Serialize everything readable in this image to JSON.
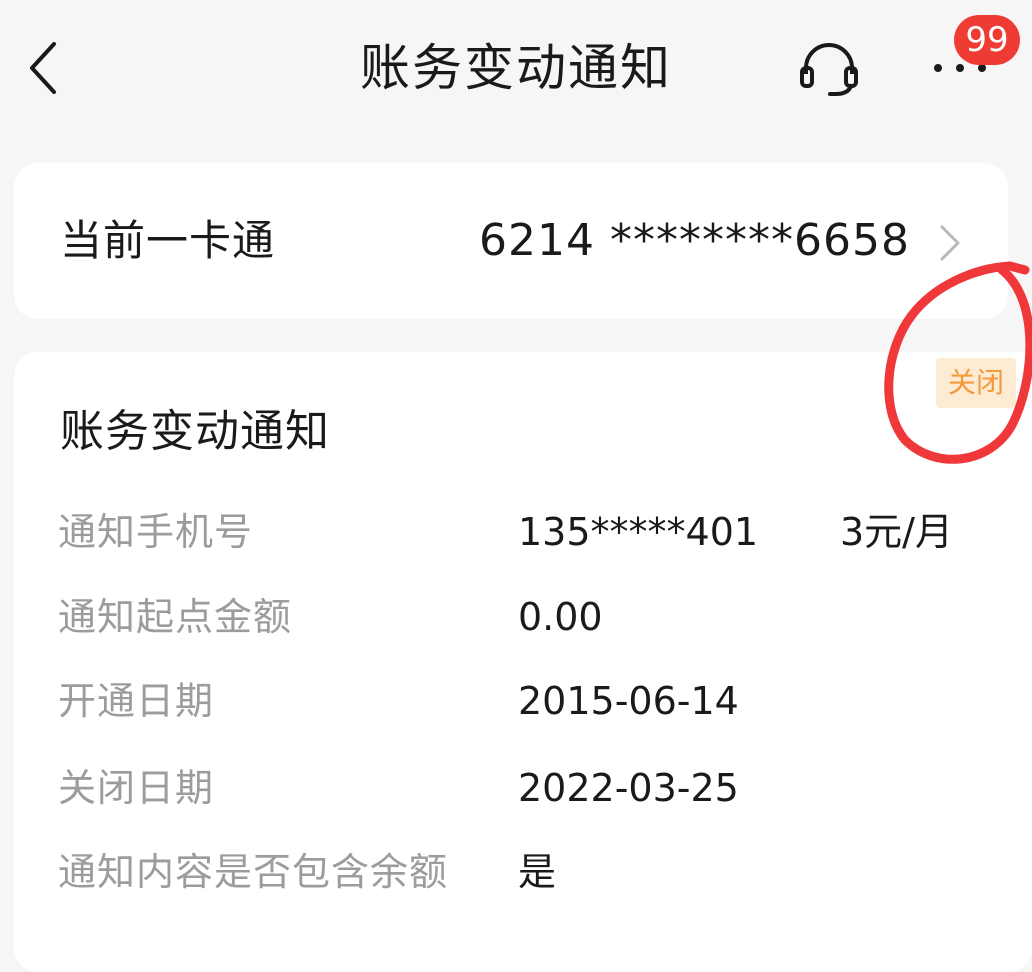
{
  "header": {
    "title": "账务变动通知",
    "back_icon": "chevron-left-icon",
    "service_icon": "headset-icon",
    "more_icon": "more-dots-icon",
    "badge_count": "99"
  },
  "account_card": {
    "label": "当前一卡通",
    "number": "6214 ********6658",
    "arrow_icon": "chevron-right-icon"
  },
  "notification": {
    "title": "账务变动通知",
    "status": "关闭",
    "rows": [
      {
        "label": "通知手机号",
        "value": "135*****401",
        "extra": "3元/月"
      },
      {
        "label": "通知起点金额",
        "value": "0.00"
      },
      {
        "label": "开通日期",
        "value": "2015-06-14"
      },
      {
        "label": "关闭日期",
        "value": "2022-03-25"
      },
      {
        "label": "通知内容是否包含余额",
        "value": "是"
      }
    ]
  },
  "colors": {
    "background": "#f6f6f6",
    "card": "#ffffff",
    "badge": "#ee3b34",
    "status_text": "#f39a3c",
    "status_bg": "#fdebd3",
    "annotation": "#f0383b"
  }
}
